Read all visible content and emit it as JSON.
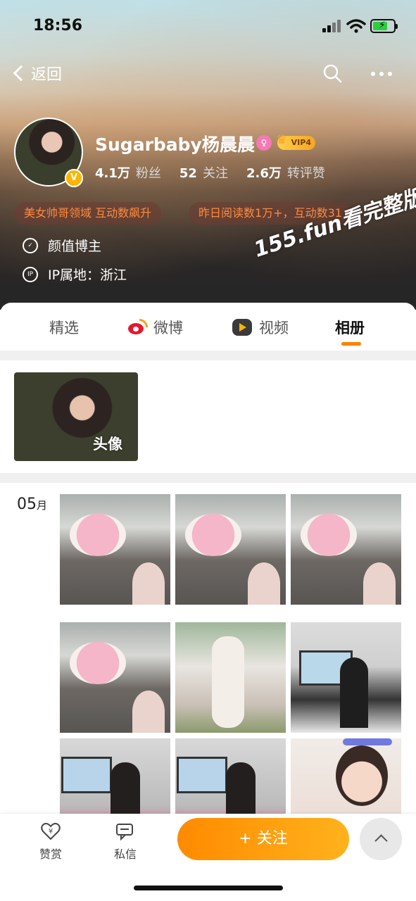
{
  "status": {
    "time": "18:56"
  },
  "nav": {
    "back_label": "返回"
  },
  "profile": {
    "username": "Sugarbaby杨晨晨",
    "vip_level": "VIP4",
    "verified_badge": "V",
    "stats": [
      {
        "value": "4.1万",
        "label": "粉丝"
      },
      {
        "value": "52",
        "label": "关注"
      },
      {
        "value": "2.6万",
        "label": "转评赞"
      }
    ],
    "tags": [
      "美女帅哥领域 互动数飙升",
      "昨日阅读数1万+，互动数31"
    ],
    "category": "颜值博主",
    "ip_icon_text": "IP",
    "ip_location": "IP属地：浙江"
  },
  "watermark": "155.fun看完整版",
  "tabs": [
    {
      "label": "精选",
      "active": false
    },
    {
      "label": "微博",
      "active": false
    },
    {
      "label": "视频",
      "active": false
    },
    {
      "label": "相册",
      "active": true
    }
  ],
  "album": {
    "label": "头像"
  },
  "month": {
    "number": "05",
    "unit": "月"
  },
  "bottom": {
    "reward_label": "赞赏",
    "message_label": "私信",
    "follow_label": "+ 关注"
  },
  "colors": {
    "accent": "#ff8200",
    "tag_text": "#ff8a3d",
    "vip": "#f5a623",
    "weibo_red": "#e6162d"
  }
}
